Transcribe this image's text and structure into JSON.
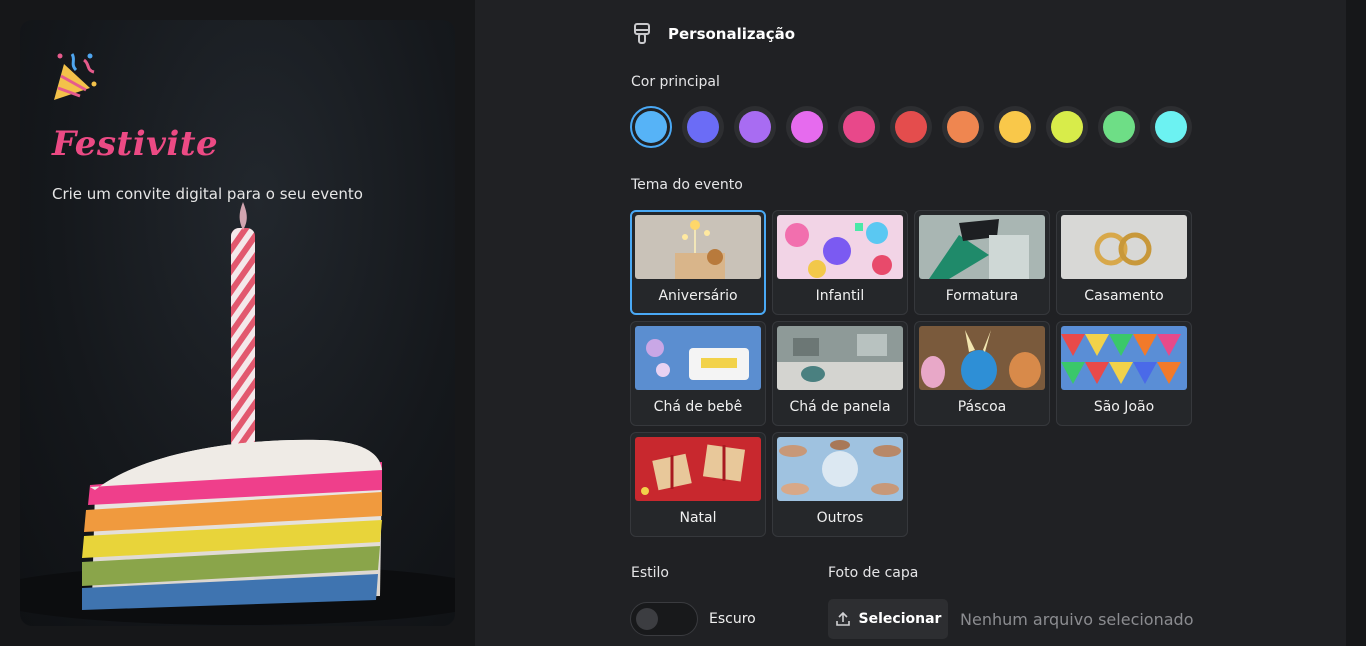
{
  "hero": {
    "title": "Festivite",
    "subtitle": "Crie um convite digital para o seu evento"
  },
  "customization": {
    "heading": "Personalização",
    "main_color_label": "Cor principal",
    "colors": [
      "#56b3f7",
      "#6b6cf6",
      "#a86cf2",
      "#e66bee",
      "#e8488a",
      "#e44d4d",
      "#ef8650",
      "#f9c84a",
      "#d8ec4a",
      "#6ede86",
      "#6cf2f2"
    ],
    "selected_color_index": 0,
    "theme_label": "Tema do evento",
    "themes": [
      {
        "label": "Aniversário"
      },
      {
        "label": "Infantil"
      },
      {
        "label": "Formatura"
      },
      {
        "label": "Casamento"
      },
      {
        "label": "Chá de bebê"
      },
      {
        "label": "Chá de panela"
      },
      {
        "label": "Páscoa"
      },
      {
        "label": "São João"
      },
      {
        "label": "Natal"
      },
      {
        "label": "Outros"
      }
    ],
    "selected_theme_index": 0,
    "style_label": "Estilo",
    "style_value": "Escuro",
    "cover_label": "Foto de capa",
    "cover_button": "Selecionar",
    "cover_status": "Nenhum arquivo selecionado"
  }
}
